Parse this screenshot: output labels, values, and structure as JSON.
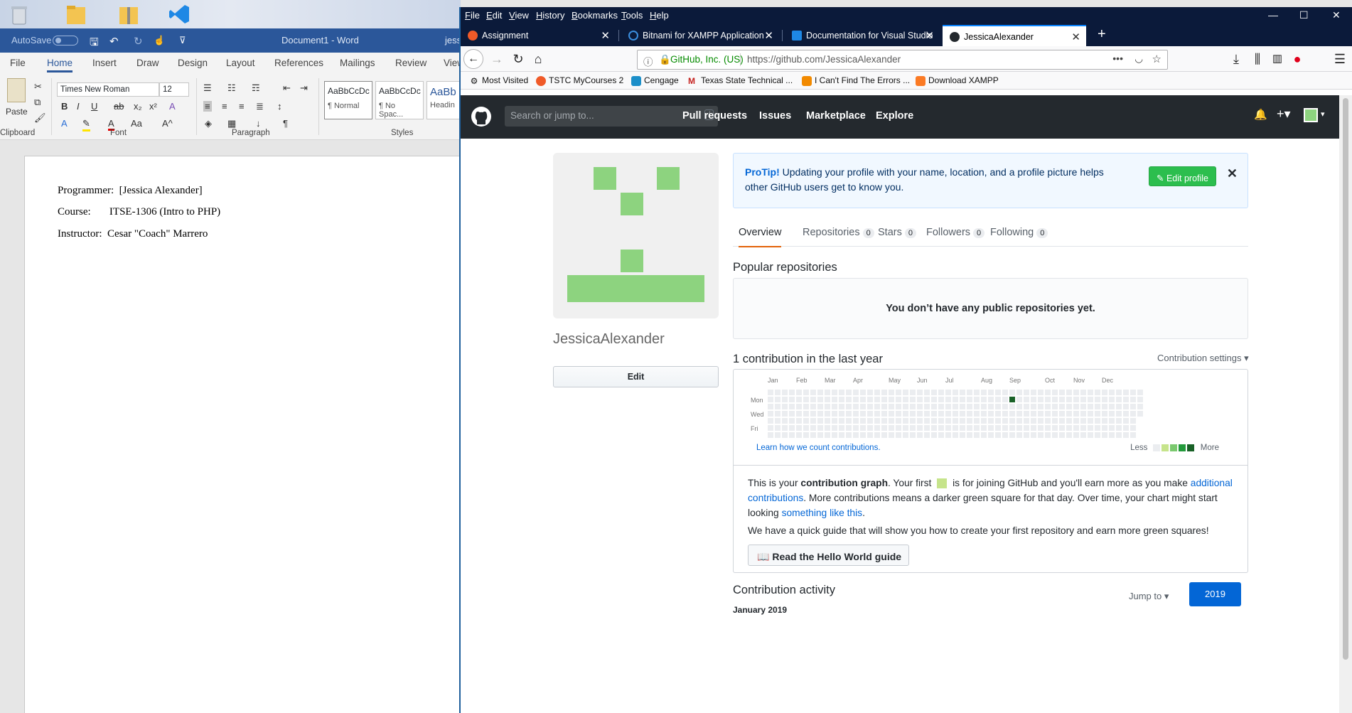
{
  "colors": {
    "word_blue": "#2b579a",
    "github_dark": "#24292e",
    "firefox_dark": "#0b1a3a",
    "avatar_green": "#8dd37f",
    "link_blue": "#0366d6",
    "contrib_green": "#196127"
  },
  "desktop": {
    "icons": [
      "recycle-bin-icon",
      "folder-icon",
      "zip-folder-icon",
      "vscode-icon"
    ]
  },
  "word": {
    "title": "Document1  -  Word",
    "title_user": "jess",
    "autosave": "AutoSave",
    "autosave_state": "Off",
    "tabs": [
      "File",
      "Home",
      "Insert",
      "Draw",
      "Design",
      "Layout",
      "References",
      "Mailings",
      "Review",
      "View"
    ],
    "ribbon": {
      "paste": "Paste",
      "font_name": "Times New Roman",
      "font_size": "12",
      "style_1_sample": "AaBbCcDc",
      "style_1_name": "¶ Normal",
      "style_2_sample": "AaBbCcDc",
      "style_2_name": "¶ No Spac...",
      "style_3_sample": "AaBb",
      "style_3_name": "Headin",
      "groups": [
        "Clipboard",
        "Font",
        "Paragraph",
        "Styles"
      ]
    },
    "document": {
      "lines": [
        "Programmer:  [Jessica Alexander]",
        "Course:       ITSE-1306 (Intro to PHP)",
        "Instructor:  Cesar \"Coach\" Marrero"
      ]
    }
  },
  "firefox": {
    "menu": [
      "File",
      "Edit",
      "View",
      "History",
      "Bookmarks",
      "Tools",
      "Help"
    ],
    "tabs": [
      {
        "label": "Assignment"
      },
      {
        "label": "Bitnami for XAMPP Application"
      },
      {
        "label": "Documentation for Visual Studio"
      },
      {
        "label": "JessicaAlexander"
      }
    ],
    "url_org": "GitHub, Inc. (US)",
    "url": "https://github.com/JessicaAlexander",
    "bookmarks": [
      "Most Visited",
      "TSTC MyCourses 2",
      "Cengage",
      "Texas State Technical ...",
      "I Can't Find The Errors ...",
      "Download XAMPP"
    ]
  },
  "github": {
    "search_placeholder": "Search or jump to...",
    "search_key": "/",
    "nav": [
      "Pull requests",
      "Issues",
      "Marketplace",
      "Explore"
    ],
    "username": "JessicaAlexander",
    "edit_button": "Edit",
    "protip_label": "ProTip!",
    "protip_text": "Updating your profile with your name, location, and a profile picture helps other GitHub users get to know you.",
    "protip_button": "Edit profile",
    "profile_tabs": [
      {
        "label": "Overview",
        "count": ""
      },
      {
        "label": "Repositories",
        "count": "0"
      },
      {
        "label": "Stars",
        "count": "0"
      },
      {
        "label": "Followers",
        "count": "0"
      },
      {
        "label": "Following",
        "count": "0"
      }
    ],
    "popular_heading": "Popular repositories",
    "no_repos": "You don’t have any public repositories yet.",
    "contrib_heading": "1 contribution in the last year",
    "contrib_settings": "Contribution settings ▾",
    "months": [
      "Jan",
      "Feb",
      "Mar",
      "Apr",
      "May",
      "Jun",
      "Jul",
      "Aug",
      "Sep",
      "Oct",
      "Nov",
      "Dec"
    ],
    "weekdays": [
      "Mon",
      "Wed",
      "Fri"
    ],
    "learn_link": "Learn how we count contributions.",
    "legend_less": "Less",
    "legend_more": "More",
    "explain_1a": "This is your",
    "explain_1b": "contribution graph",
    "explain_1c": ". Your first",
    "explain_1d": "is for joining GitHub and you'll earn more as you make",
    "explain_link1": "additional contributions",
    "explain_2": ". More contributions means a darker green square for that day. Over time, your chart might start looking",
    "explain_link2": "something like this",
    "explain_3": ".",
    "explain_para2": "We have a quick guide that will show you how to create your first repository and earn more green squares!",
    "guide_button": "Read the Hello World guide",
    "activity_heading": "Contribution activity",
    "jump_to": "Jump to ▾",
    "year": "2019",
    "month_label": "January 2019"
  }
}
